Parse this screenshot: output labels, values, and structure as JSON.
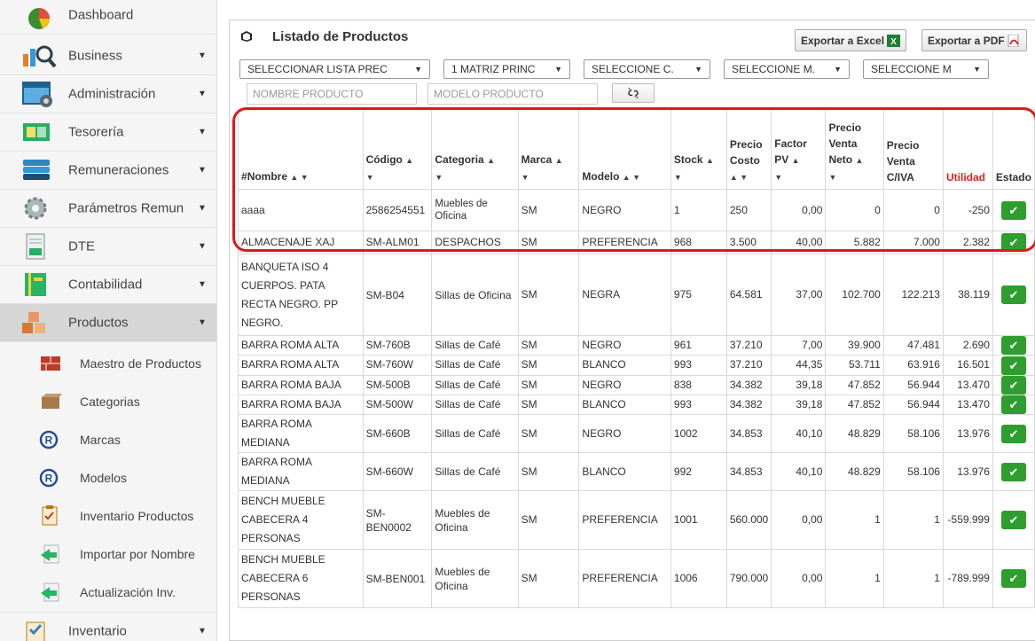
{
  "sidebar": {
    "menu": [
      {
        "label": "Dashboard",
        "icon": "pie-chart-icon",
        "caret": false
      },
      {
        "label": "Business",
        "icon": "magnifier-chart-icon",
        "caret": true
      },
      {
        "label": "Administración",
        "icon": "admin-window-icon",
        "caret": true
      },
      {
        "label": "Tesorería",
        "icon": "treasury-icon",
        "caret": true
      },
      {
        "label": "Remuneraciones",
        "icon": "books-icon",
        "caret": true
      },
      {
        "label": "Parámetros Remun",
        "icon": "gears-icon",
        "caret": true
      },
      {
        "label": "DTE",
        "icon": "document-icon",
        "caret": true
      },
      {
        "label": "Contabilidad",
        "icon": "ledger-icon",
        "caret": true
      },
      {
        "label": "Productos",
        "icon": "boxes-icon",
        "caret": true,
        "active": true
      }
    ],
    "submenu": [
      {
        "label": "Maestro de Productos",
        "icon": "bricks-icon"
      },
      {
        "label": "Categorias",
        "icon": "box-icon"
      },
      {
        "label": "Marcas",
        "icon": "registered-icon"
      },
      {
        "label": "Modelos",
        "icon": "registered-icon"
      },
      {
        "label": "Inventario Productos",
        "icon": "checklist-icon"
      },
      {
        "label": "Importar por Nombre",
        "icon": "import-arrow-icon"
      },
      {
        "label": "Actualización Inv.",
        "icon": "import-arrow-icon"
      }
    ],
    "bottom": {
      "label": "Inventario",
      "icon": "inventory-icon"
    }
  },
  "panel": {
    "title": "Listado de Productos",
    "export_excel": "Exportar a Excel",
    "export_pdf": "Exportar a PDF"
  },
  "filters": {
    "lista": "SELECCIONAR LISTA PREC",
    "matriz": "1 MATRIZ PRINC",
    "categoria": "SELECCIONE C.",
    "marca": "SELECCIONE M.",
    "modelo": "SELECCIONE M",
    "nombre_placeholder": "NOMBRE PRODUCTO",
    "modelo_placeholder": "MODELO PRODUCTO"
  },
  "table": {
    "headers": {
      "num": "#",
      "nombre": "Nombre",
      "codigo": "Código",
      "categoria": "Categoria",
      "marca": "Marca",
      "modelo": "Modelo",
      "stock": "Stock",
      "precio_costo": "Precio Costo",
      "factor_pv": "Factor PV",
      "precio_venta_neto": "Precio Venta Neto",
      "precio_venta_civa": "Precio Venta C/IVA",
      "utilidad": "Utilidad",
      "estado": "Estado"
    },
    "rows": [
      {
        "nombre": "aaaa",
        "codigo": "2586254551",
        "categoria": "Muebles de Oficina",
        "marca": "SM",
        "modelo": "NEGRO",
        "stock": "1",
        "costo": "250",
        "factor": "0,00",
        "neto": "0",
        "civa": "0",
        "utilidad": "-250"
      },
      {
        "nombre": "ALMACENAJE XAJ",
        "codigo": "SM-ALM01",
        "categoria": "DESPACHOS",
        "marca": "SM",
        "modelo": "PREFERENCIA",
        "stock": "968",
        "costo": "3.500",
        "factor": "40,00",
        "neto": "5.882",
        "civa": "7.000",
        "utilidad": "2.382"
      },
      {
        "nombre": "BANQUETA ISO 4 CUERPOS. PATA RECTA NEGRO. PP NEGRO.",
        "codigo": "SM-B04",
        "categoria": "Sillas de Oficina",
        "marca": "SM",
        "modelo": "NEGRA",
        "stock": "975",
        "costo": "64.581",
        "factor": "37,00",
        "neto": "102.700",
        "civa": "122.213",
        "utilidad": "38.119"
      },
      {
        "nombre": "BARRA ROMA ALTA",
        "codigo": "SM-760B",
        "categoria": "Sillas de Café",
        "marca": "SM",
        "modelo": "NEGRO",
        "stock": "961",
        "costo": "37.210",
        "factor": "7,00",
        "neto": "39.900",
        "civa": "47.481",
        "utilidad": "2.690"
      },
      {
        "nombre": "BARRA ROMA ALTA",
        "codigo": "SM-760W",
        "categoria": "Sillas de Café",
        "marca": "SM",
        "modelo": "BLANCO",
        "stock": "993",
        "costo": "37.210",
        "factor": "44,35",
        "neto": "53.711",
        "civa": "63.916",
        "utilidad": "16.501"
      },
      {
        "nombre": "BARRA ROMA BAJA",
        "codigo": "SM-500B",
        "categoria": "Sillas de Café",
        "marca": "SM",
        "modelo": "NEGRO",
        "stock": "838",
        "costo": "34.382",
        "factor": "39,18",
        "neto": "47.852",
        "civa": "56.944",
        "utilidad": "13.470"
      },
      {
        "nombre": "BARRA ROMA BAJA",
        "codigo": "SM-500W",
        "categoria": "Sillas de Café",
        "marca": "SM",
        "modelo": "BLANCO",
        "stock": "993",
        "costo": "34.382",
        "factor": "39,18",
        "neto": "47.852",
        "civa": "56.944",
        "utilidad": "13.470"
      },
      {
        "nombre": "BARRA ROMA MEDIANA",
        "codigo": "SM-660B",
        "categoria": "Sillas de Café",
        "marca": "SM",
        "modelo": "NEGRO",
        "stock": "1002",
        "costo": "34.853",
        "factor": "40,10",
        "neto": "48.829",
        "civa": "58.106",
        "utilidad": "13.976"
      },
      {
        "nombre": "BARRA ROMA MEDIANA",
        "codigo": "SM-660W",
        "categoria": "Sillas de Café",
        "marca": "SM",
        "modelo": "BLANCO",
        "stock": "992",
        "costo": "34.853",
        "factor": "40,10",
        "neto": "48.829",
        "civa": "58.106",
        "utilidad": "13.976"
      },
      {
        "nombre": "BENCH MUEBLE CABECERA 4 PERSONAS",
        "codigo": "SM-BEN0002",
        "categoria": "Muebles de Oficina",
        "marca": "SM",
        "modelo": "PREFERENCIA",
        "stock": "1001",
        "costo": "560.000",
        "factor": "0,00",
        "neto": "1",
        "civa": "1",
        "utilidad": "-559.999"
      },
      {
        "nombre": "BENCH MUEBLE CABECERA 6 PERSONAS",
        "codigo": "SM-BEN001",
        "categoria": "Muebles de Oficina",
        "marca": "SM",
        "modelo": "PREFERENCIA",
        "stock": "1006",
        "costo": "790.000",
        "factor": "0,00",
        "neto": "1",
        "civa": "1",
        "utilidad": "-789.999"
      }
    ]
  },
  "colors": {
    "highlight": "#e01818",
    "estado_ok": "#2e9e2e",
    "utilidad_header": "#e02020"
  }
}
